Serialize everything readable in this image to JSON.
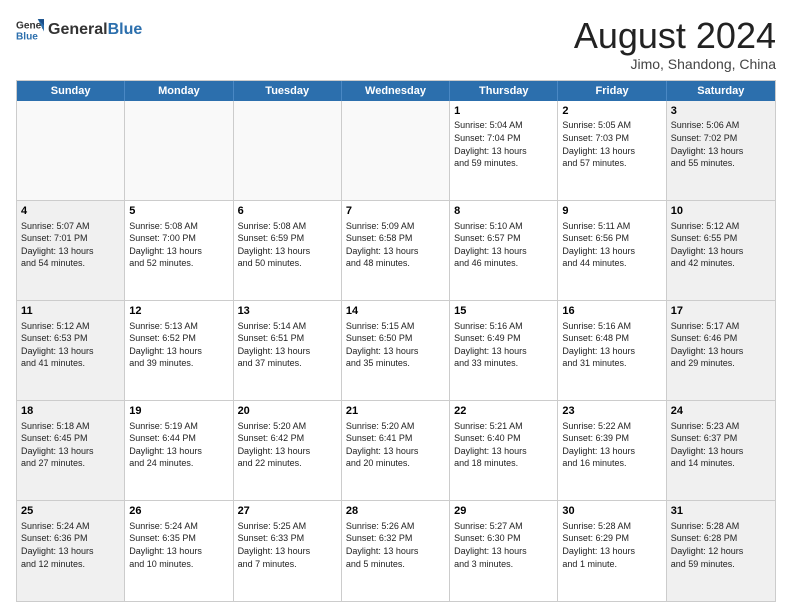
{
  "header": {
    "logo_general": "General",
    "logo_blue": "Blue",
    "month_title": "August 2024",
    "location": "Jimo, Shandong, China"
  },
  "weekdays": [
    "Sunday",
    "Monday",
    "Tuesday",
    "Wednesday",
    "Thursday",
    "Friday",
    "Saturday"
  ],
  "weeks": [
    [
      {
        "day": "",
        "text": "",
        "empty": true
      },
      {
        "day": "",
        "text": "",
        "empty": true
      },
      {
        "day": "",
        "text": "",
        "empty": true
      },
      {
        "day": "",
        "text": "",
        "empty": true
      },
      {
        "day": "1",
        "text": "Sunrise: 5:04 AM\nSunset: 7:04 PM\nDaylight: 13 hours\nand 59 minutes.",
        "empty": false
      },
      {
        "day": "2",
        "text": "Sunrise: 5:05 AM\nSunset: 7:03 PM\nDaylight: 13 hours\nand 57 minutes.",
        "empty": false
      },
      {
        "day": "3",
        "text": "Sunrise: 5:06 AM\nSunset: 7:02 PM\nDaylight: 13 hours\nand 55 minutes.",
        "empty": false,
        "shaded": true
      }
    ],
    [
      {
        "day": "4",
        "text": "Sunrise: 5:07 AM\nSunset: 7:01 PM\nDaylight: 13 hours\nand 54 minutes.",
        "empty": false,
        "shaded": true
      },
      {
        "day": "5",
        "text": "Sunrise: 5:08 AM\nSunset: 7:00 PM\nDaylight: 13 hours\nand 52 minutes.",
        "empty": false
      },
      {
        "day": "6",
        "text": "Sunrise: 5:08 AM\nSunset: 6:59 PM\nDaylight: 13 hours\nand 50 minutes.",
        "empty": false
      },
      {
        "day": "7",
        "text": "Sunrise: 5:09 AM\nSunset: 6:58 PM\nDaylight: 13 hours\nand 48 minutes.",
        "empty": false
      },
      {
        "day": "8",
        "text": "Sunrise: 5:10 AM\nSunset: 6:57 PM\nDaylight: 13 hours\nand 46 minutes.",
        "empty": false
      },
      {
        "day": "9",
        "text": "Sunrise: 5:11 AM\nSunset: 6:56 PM\nDaylight: 13 hours\nand 44 minutes.",
        "empty": false
      },
      {
        "day": "10",
        "text": "Sunrise: 5:12 AM\nSunset: 6:55 PM\nDaylight: 13 hours\nand 42 minutes.",
        "empty": false,
        "shaded": true
      }
    ],
    [
      {
        "day": "11",
        "text": "Sunrise: 5:12 AM\nSunset: 6:53 PM\nDaylight: 13 hours\nand 41 minutes.",
        "empty": false,
        "shaded": true
      },
      {
        "day": "12",
        "text": "Sunrise: 5:13 AM\nSunset: 6:52 PM\nDaylight: 13 hours\nand 39 minutes.",
        "empty": false
      },
      {
        "day": "13",
        "text": "Sunrise: 5:14 AM\nSunset: 6:51 PM\nDaylight: 13 hours\nand 37 minutes.",
        "empty": false
      },
      {
        "day": "14",
        "text": "Sunrise: 5:15 AM\nSunset: 6:50 PM\nDaylight: 13 hours\nand 35 minutes.",
        "empty": false
      },
      {
        "day": "15",
        "text": "Sunrise: 5:16 AM\nSunset: 6:49 PM\nDaylight: 13 hours\nand 33 minutes.",
        "empty": false
      },
      {
        "day": "16",
        "text": "Sunrise: 5:16 AM\nSunset: 6:48 PM\nDaylight: 13 hours\nand 31 minutes.",
        "empty": false
      },
      {
        "day": "17",
        "text": "Sunrise: 5:17 AM\nSunset: 6:46 PM\nDaylight: 13 hours\nand 29 minutes.",
        "empty": false,
        "shaded": true
      }
    ],
    [
      {
        "day": "18",
        "text": "Sunrise: 5:18 AM\nSunset: 6:45 PM\nDaylight: 13 hours\nand 27 minutes.",
        "empty": false,
        "shaded": true
      },
      {
        "day": "19",
        "text": "Sunrise: 5:19 AM\nSunset: 6:44 PM\nDaylight: 13 hours\nand 24 minutes.",
        "empty": false
      },
      {
        "day": "20",
        "text": "Sunrise: 5:20 AM\nSunset: 6:42 PM\nDaylight: 13 hours\nand 22 minutes.",
        "empty": false
      },
      {
        "day": "21",
        "text": "Sunrise: 5:20 AM\nSunset: 6:41 PM\nDaylight: 13 hours\nand 20 minutes.",
        "empty": false
      },
      {
        "day": "22",
        "text": "Sunrise: 5:21 AM\nSunset: 6:40 PM\nDaylight: 13 hours\nand 18 minutes.",
        "empty": false
      },
      {
        "day": "23",
        "text": "Sunrise: 5:22 AM\nSunset: 6:39 PM\nDaylight: 13 hours\nand 16 minutes.",
        "empty": false
      },
      {
        "day": "24",
        "text": "Sunrise: 5:23 AM\nSunset: 6:37 PM\nDaylight: 13 hours\nand 14 minutes.",
        "empty": false,
        "shaded": true
      }
    ],
    [
      {
        "day": "25",
        "text": "Sunrise: 5:24 AM\nSunset: 6:36 PM\nDaylight: 13 hours\nand 12 minutes.",
        "empty": false,
        "shaded": true
      },
      {
        "day": "26",
        "text": "Sunrise: 5:24 AM\nSunset: 6:35 PM\nDaylight: 13 hours\nand 10 minutes.",
        "empty": false
      },
      {
        "day": "27",
        "text": "Sunrise: 5:25 AM\nSunset: 6:33 PM\nDaylight: 13 hours\nand 7 minutes.",
        "empty": false
      },
      {
        "day": "28",
        "text": "Sunrise: 5:26 AM\nSunset: 6:32 PM\nDaylight: 13 hours\nand 5 minutes.",
        "empty": false
      },
      {
        "day": "29",
        "text": "Sunrise: 5:27 AM\nSunset: 6:30 PM\nDaylight: 13 hours\nand 3 minutes.",
        "empty": false
      },
      {
        "day": "30",
        "text": "Sunrise: 5:28 AM\nSunset: 6:29 PM\nDaylight: 13 hours\nand 1 minute.",
        "empty": false
      },
      {
        "day": "31",
        "text": "Sunrise: 5:28 AM\nSunset: 6:28 PM\nDaylight: 12 hours\nand 59 minutes.",
        "empty": false,
        "shaded": true
      }
    ]
  ]
}
